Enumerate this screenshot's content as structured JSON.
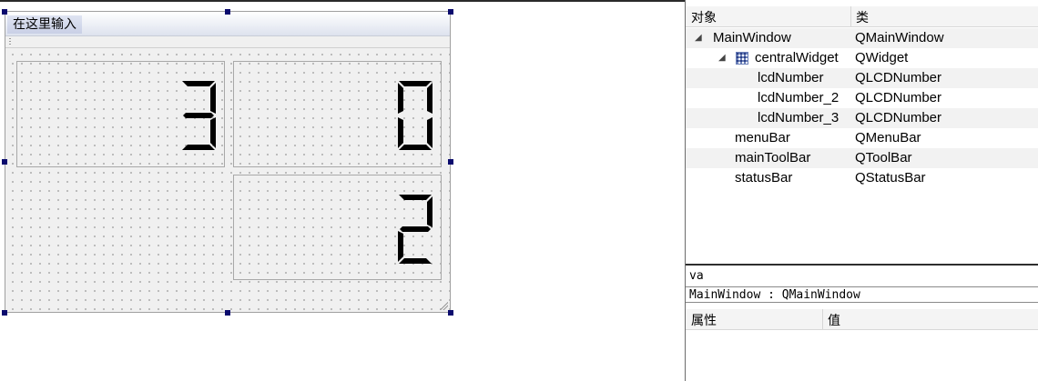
{
  "form": {
    "menu_placeholder": "在这里输入",
    "lcd_values": {
      "lcd1": "3",
      "lcd2": "0",
      "lcd3": "2"
    }
  },
  "object_inspector": {
    "col_object": "对象",
    "col_class": "类",
    "rows": [
      {
        "name": "MainWindow",
        "class": "QMainWindow",
        "expanded": true
      },
      {
        "name": "centralWidget",
        "class": "QWidget",
        "expanded": true,
        "icon": "grid-layout-icon"
      },
      {
        "name": "lcdNumber",
        "class": "QLCDNumber"
      },
      {
        "name": "lcdNumber_2",
        "class": "QLCDNumber"
      },
      {
        "name": "lcdNumber_3",
        "class": "QLCDNumber"
      },
      {
        "name": "menuBar",
        "class": "QMenuBar"
      },
      {
        "name": "mainToolBar",
        "class": "QToolBar"
      },
      {
        "name": "statusBar",
        "class": "QStatusBar"
      }
    ]
  },
  "property_editor": {
    "filter_value": "va",
    "class_label": "MainWindow : QMainWindow",
    "col_property": "属性",
    "col_value": "值"
  },
  "colors": {
    "selection_handle": "#0b0b6e",
    "lcd_segment": "#000000"
  }
}
